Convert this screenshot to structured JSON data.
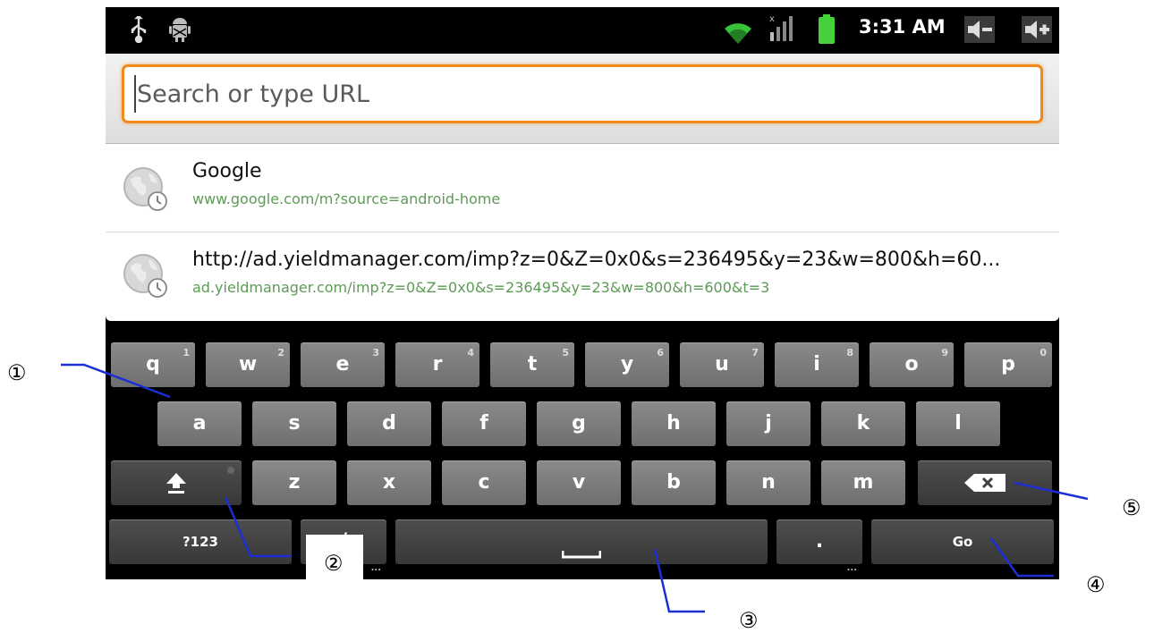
{
  "status_bar": {
    "time": "3:31 AM",
    "icons": [
      "usb-icon",
      "android-debug-icon",
      "wifi-icon",
      "signal-icon",
      "battery-icon",
      "volume-down-icon",
      "volume-up-icon"
    ]
  },
  "address_bar": {
    "placeholder": "Search or type URL",
    "value": ""
  },
  "suggestions": [
    {
      "title": "Google",
      "url": "www.google.com/m?source=android-home",
      "icon": "history-globe-icon"
    },
    {
      "title": "http://ad.yieldmanager.com/imp?z=0&Z=0x0&s=236495&y=23&w=800&h=60...",
      "url": "ad.yieldmanager.com/imp?z=0&Z=0x0&s=236495&y=23&w=800&h=600&t=3",
      "icon": "history-globe-icon"
    }
  ],
  "keyboard": {
    "row1": [
      {
        "label": "q",
        "hint": "1"
      },
      {
        "label": "w",
        "hint": "2"
      },
      {
        "label": "e",
        "hint": "3"
      },
      {
        "label": "r",
        "hint": "4"
      },
      {
        "label": "t",
        "hint": "5"
      },
      {
        "label": "y",
        "hint": "6"
      },
      {
        "label": "u",
        "hint": "7"
      },
      {
        "label": "i",
        "hint": "8"
      },
      {
        "label": "o",
        "hint": "9"
      },
      {
        "label": "p",
        "hint": "0"
      }
    ],
    "row2": [
      "a",
      "s",
      "d",
      "f",
      "g",
      "h",
      "j",
      "k",
      "l"
    ],
    "row3": [
      "z",
      "x",
      "c",
      "v",
      "b",
      "n",
      "m"
    ],
    "symbols_label": "?123",
    "slash_label": "/",
    "period_label": ".",
    "go_label": "Go",
    "more_hint": "..."
  },
  "callouts": [
    "①",
    "②",
    "③",
    "④",
    "⑤"
  ],
  "colors": {
    "focus_border": "#f08a1a",
    "url_green": "#5c9b55",
    "wifi_green": "#37c23a",
    "battery_green": "#45d13a"
  }
}
